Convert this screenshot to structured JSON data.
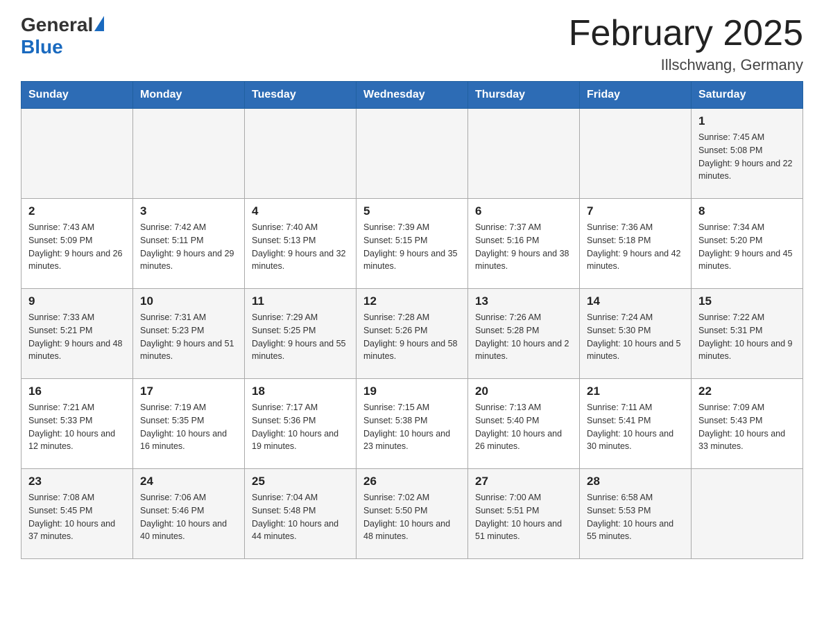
{
  "header": {
    "logo_general": "General",
    "logo_blue": "Blue",
    "title": "February 2025",
    "subtitle": "Illschwang, Germany"
  },
  "weekdays": [
    "Sunday",
    "Monday",
    "Tuesday",
    "Wednesday",
    "Thursday",
    "Friday",
    "Saturday"
  ],
  "weeks": [
    [
      {
        "day": "",
        "info": ""
      },
      {
        "day": "",
        "info": ""
      },
      {
        "day": "",
        "info": ""
      },
      {
        "day": "",
        "info": ""
      },
      {
        "day": "",
        "info": ""
      },
      {
        "day": "",
        "info": ""
      },
      {
        "day": "1",
        "info": "Sunrise: 7:45 AM\nSunset: 5:08 PM\nDaylight: 9 hours\nand 22 minutes."
      }
    ],
    [
      {
        "day": "2",
        "info": "Sunrise: 7:43 AM\nSunset: 5:09 PM\nDaylight: 9 hours\nand 26 minutes."
      },
      {
        "day": "3",
        "info": "Sunrise: 7:42 AM\nSunset: 5:11 PM\nDaylight: 9 hours\nand 29 minutes."
      },
      {
        "day": "4",
        "info": "Sunrise: 7:40 AM\nSunset: 5:13 PM\nDaylight: 9 hours\nand 32 minutes."
      },
      {
        "day": "5",
        "info": "Sunrise: 7:39 AM\nSunset: 5:15 PM\nDaylight: 9 hours\nand 35 minutes."
      },
      {
        "day": "6",
        "info": "Sunrise: 7:37 AM\nSunset: 5:16 PM\nDaylight: 9 hours\nand 38 minutes."
      },
      {
        "day": "7",
        "info": "Sunrise: 7:36 AM\nSunset: 5:18 PM\nDaylight: 9 hours\nand 42 minutes."
      },
      {
        "day": "8",
        "info": "Sunrise: 7:34 AM\nSunset: 5:20 PM\nDaylight: 9 hours\nand 45 minutes."
      }
    ],
    [
      {
        "day": "9",
        "info": "Sunrise: 7:33 AM\nSunset: 5:21 PM\nDaylight: 9 hours\nand 48 minutes."
      },
      {
        "day": "10",
        "info": "Sunrise: 7:31 AM\nSunset: 5:23 PM\nDaylight: 9 hours\nand 51 minutes."
      },
      {
        "day": "11",
        "info": "Sunrise: 7:29 AM\nSunset: 5:25 PM\nDaylight: 9 hours\nand 55 minutes."
      },
      {
        "day": "12",
        "info": "Sunrise: 7:28 AM\nSunset: 5:26 PM\nDaylight: 9 hours\nand 58 minutes."
      },
      {
        "day": "13",
        "info": "Sunrise: 7:26 AM\nSunset: 5:28 PM\nDaylight: 10 hours\nand 2 minutes."
      },
      {
        "day": "14",
        "info": "Sunrise: 7:24 AM\nSunset: 5:30 PM\nDaylight: 10 hours\nand 5 minutes."
      },
      {
        "day": "15",
        "info": "Sunrise: 7:22 AM\nSunset: 5:31 PM\nDaylight: 10 hours\nand 9 minutes."
      }
    ],
    [
      {
        "day": "16",
        "info": "Sunrise: 7:21 AM\nSunset: 5:33 PM\nDaylight: 10 hours\nand 12 minutes."
      },
      {
        "day": "17",
        "info": "Sunrise: 7:19 AM\nSunset: 5:35 PM\nDaylight: 10 hours\nand 16 minutes."
      },
      {
        "day": "18",
        "info": "Sunrise: 7:17 AM\nSunset: 5:36 PM\nDaylight: 10 hours\nand 19 minutes."
      },
      {
        "day": "19",
        "info": "Sunrise: 7:15 AM\nSunset: 5:38 PM\nDaylight: 10 hours\nand 23 minutes."
      },
      {
        "day": "20",
        "info": "Sunrise: 7:13 AM\nSunset: 5:40 PM\nDaylight: 10 hours\nand 26 minutes."
      },
      {
        "day": "21",
        "info": "Sunrise: 7:11 AM\nSunset: 5:41 PM\nDaylight: 10 hours\nand 30 minutes."
      },
      {
        "day": "22",
        "info": "Sunrise: 7:09 AM\nSunset: 5:43 PM\nDaylight: 10 hours\nand 33 minutes."
      }
    ],
    [
      {
        "day": "23",
        "info": "Sunrise: 7:08 AM\nSunset: 5:45 PM\nDaylight: 10 hours\nand 37 minutes."
      },
      {
        "day": "24",
        "info": "Sunrise: 7:06 AM\nSunset: 5:46 PM\nDaylight: 10 hours\nand 40 minutes."
      },
      {
        "day": "25",
        "info": "Sunrise: 7:04 AM\nSunset: 5:48 PM\nDaylight: 10 hours\nand 44 minutes."
      },
      {
        "day": "26",
        "info": "Sunrise: 7:02 AM\nSunset: 5:50 PM\nDaylight: 10 hours\nand 48 minutes."
      },
      {
        "day": "27",
        "info": "Sunrise: 7:00 AM\nSunset: 5:51 PM\nDaylight: 10 hours\nand 51 minutes."
      },
      {
        "day": "28",
        "info": "Sunrise: 6:58 AM\nSunset: 5:53 PM\nDaylight: 10 hours\nand 55 minutes."
      },
      {
        "day": "",
        "info": ""
      }
    ]
  ]
}
